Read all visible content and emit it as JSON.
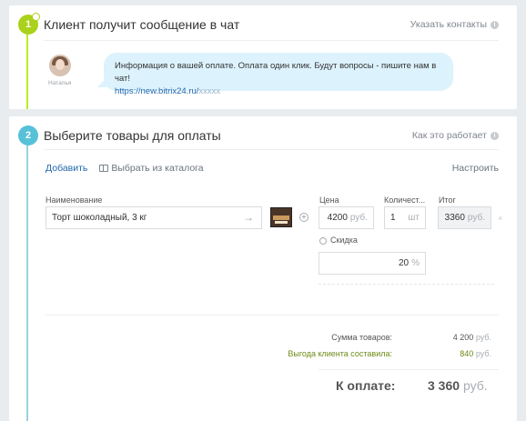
{
  "step1": {
    "number": "1",
    "title": "Клиент получит сообщение в чат",
    "right_link": "Указать контакты",
    "info_icon": "info-icon",
    "avatar_name": "Наталья",
    "message_text": "Информация о вашей оплате. Оплата один клик. Будут вопросы - пишите нам в чат!",
    "message_link": "https://new.bitrix24.ru/",
    "message_link_mask": "xxxxx"
  },
  "step2": {
    "number": "2",
    "title": "Выберите товары для оплаты",
    "right_link": "Как это работает",
    "tabs": {
      "add": "Добавить",
      "catalog": "Выбрать из каталога"
    },
    "settings": "Настроить",
    "columns": {
      "name": "Наименование",
      "price": "Цена",
      "quantity": "Количест...",
      "total": "Итог"
    },
    "product": {
      "name": "Торт шоколадный, 3 кг",
      "price": "4200",
      "price_unit": "руб.",
      "quantity": "1",
      "quantity_unit": "шт",
      "total": "3360",
      "total_unit": "руб."
    },
    "discount": {
      "label": "Скидка",
      "value": "20",
      "unit": "%"
    },
    "summary": {
      "goods_label": "Сумма товаров:",
      "goods_value": "4 200",
      "goods_unit": "руб.",
      "benefit_label": "Выгода клиента составила:",
      "benefit_value": "840",
      "benefit_unit": "руб.",
      "pay_label": "К оплате:",
      "pay_value": "3 360",
      "pay_unit": "руб."
    }
  },
  "colors": {
    "step1_accent": "#aad21b",
    "step2_accent": "#56c1d8",
    "link": "#2067b0",
    "benefit": "#6d8a16",
    "bubble": "#dcf2fc"
  }
}
